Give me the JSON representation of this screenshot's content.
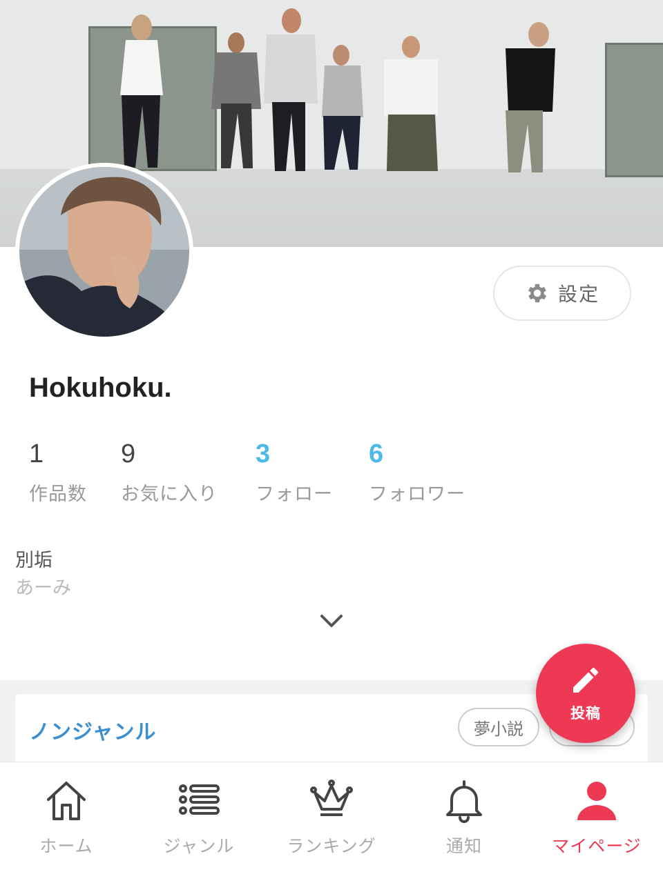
{
  "profile": {
    "username": "Hokuhoku.",
    "settings_label": "設定"
  },
  "stats": [
    {
      "value": "1",
      "label": "作品数",
      "accent": false
    },
    {
      "value": "9",
      "label": "お気に入り",
      "accent": false
    },
    {
      "value": "3",
      "label": "フォロー",
      "accent": true
    },
    {
      "value": "6",
      "label": "フォロワー",
      "accent": true
    }
  ],
  "bio": {
    "line1": "別垢",
    "line2": "あーみ"
  },
  "works_card": {
    "genre_title": "ノンジャンル",
    "tags": [
      "夢小説"
    ]
  },
  "fab": {
    "label": "投稿"
  },
  "bottom_nav": [
    {
      "label": "ホーム",
      "icon": "home-icon",
      "active": false
    },
    {
      "label": "ジャンル",
      "icon": "list-icon",
      "active": false
    },
    {
      "label": "ランキング",
      "icon": "crown-icon",
      "active": false
    },
    {
      "label": "通知",
      "icon": "bell-icon",
      "active": false
    },
    {
      "label": "マイページ",
      "icon": "user-icon",
      "active": true
    }
  ],
  "colors": {
    "accent_blue": "#4db9e8",
    "genre_blue": "#3b8fd1",
    "brand_red": "#ee3955"
  }
}
